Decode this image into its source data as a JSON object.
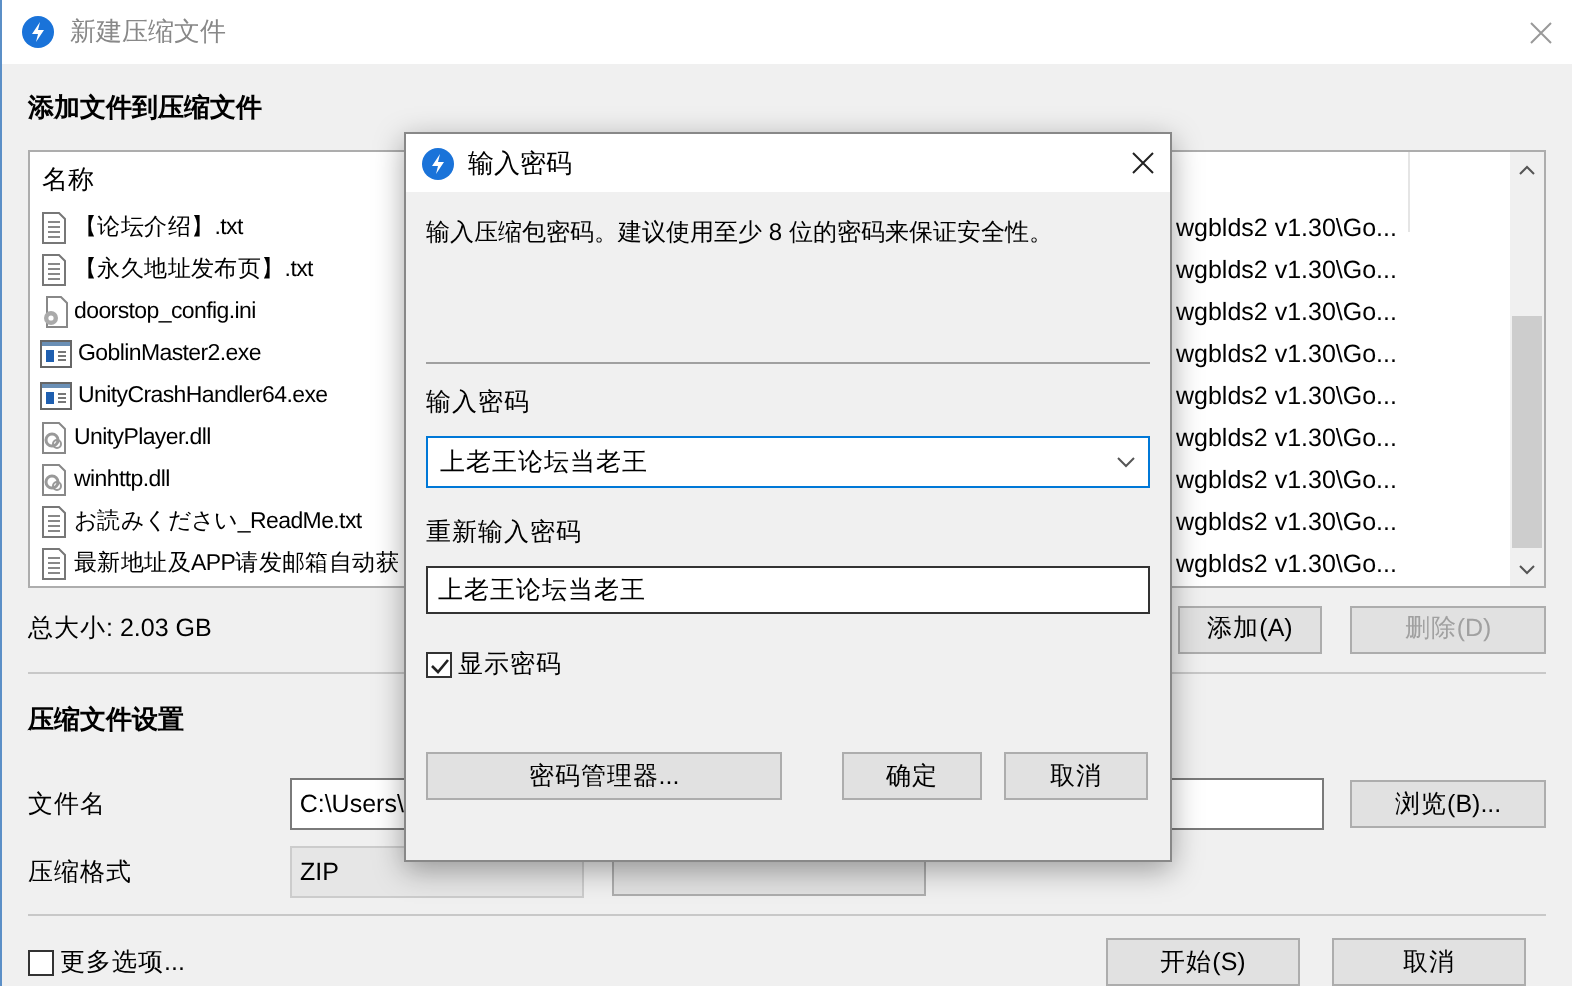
{
  "window": {
    "title": "新建压缩文件"
  },
  "add_section": {
    "heading": "添加文件到压缩文件"
  },
  "file_list": {
    "columns": [
      "名称"
    ],
    "rows": [
      {
        "kind": "text",
        "name": "【论坛介绍】.txt",
        "path": "wgblds2 v1.30\\Go..."
      },
      {
        "kind": "text",
        "name": "【永久地址发布页】.txt",
        "path": "wgblds2 v1.30\\Go..."
      },
      {
        "kind": "config",
        "name": "doorstop_config.ini",
        "path": "wgblds2 v1.30\\Go..."
      },
      {
        "kind": "exe",
        "name": "GoblinMaster2.exe",
        "path": "wgblds2 v1.30\\Go..."
      },
      {
        "kind": "exe",
        "name": "UnityCrashHandler64.exe",
        "path": "wgblds2 v1.30\\Go..."
      },
      {
        "kind": "dll",
        "name": "UnityPlayer.dll",
        "path": "wgblds2 v1.30\\Go..."
      },
      {
        "kind": "dll",
        "name": "winhttp.dll",
        "path": "wgblds2 v1.30\\Go..."
      },
      {
        "kind": "text",
        "name": "お読みください_ReadMe.txt",
        "path": "wgblds2 v1.30\\Go..."
      },
      {
        "kind": "text",
        "name": "最新地址及APP请发邮箱自动获",
        "path": "wgblds2 v1.30\\Go..."
      }
    ]
  },
  "total_size": "总大小: 2.03 GB",
  "list_buttons": [
    {
      "label": "添加(A)",
      "disabled": false
    },
    {
      "label": "删除(D)",
      "disabled": true
    }
  ],
  "settings": {
    "heading": "压缩文件设置",
    "file_name_label": "文件名",
    "file_name_value": "C:\\Users\\",
    "browse": "浏览(B)...",
    "format_label": "压缩格式",
    "format_value": "ZIP"
  },
  "more_options": {
    "label": "更多选项...",
    "checked": false
  },
  "footer_buttons": [
    "开始(S)",
    "取消"
  ],
  "dialog": {
    "title": "输入密码",
    "description": "输入压缩包密码。建议使用至少 8 位的密码来保证安全性。",
    "password_label": "输入密码",
    "password_value": "上老王论坛当老王",
    "confirm_label": "重新输入密码",
    "confirm_value": "上老王论坛当老王",
    "show_password": {
      "label": "显示密码",
      "checked": true
    },
    "manager_button": "密码管理器...",
    "ok": "确定",
    "cancel": "取消"
  }
}
